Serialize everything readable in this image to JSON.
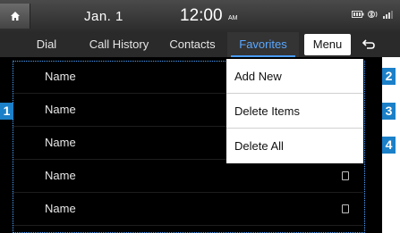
{
  "status_bar": {
    "date": "Jan.  1",
    "time": "12:00",
    "ampm": "AM"
  },
  "tabs": [
    {
      "label": "Dial",
      "active": false
    },
    {
      "label": "Call History",
      "active": false
    },
    {
      "label": "Contacts",
      "active": false
    },
    {
      "label": "Favorites",
      "active": true
    }
  ],
  "menu_button": "Menu",
  "contacts": [
    {
      "name": "Name"
    },
    {
      "name": "Name"
    },
    {
      "name": "Name"
    },
    {
      "name": "Name"
    },
    {
      "name": "Name"
    }
  ],
  "dropdown": {
    "items": [
      "Add New",
      "Delete Items",
      "Delete All"
    ]
  },
  "callouts": [
    "1",
    "2",
    "3",
    "4"
  ],
  "colors": {
    "accent": "#4a9dff",
    "callout": "#1b80c8",
    "background": "#000000"
  }
}
